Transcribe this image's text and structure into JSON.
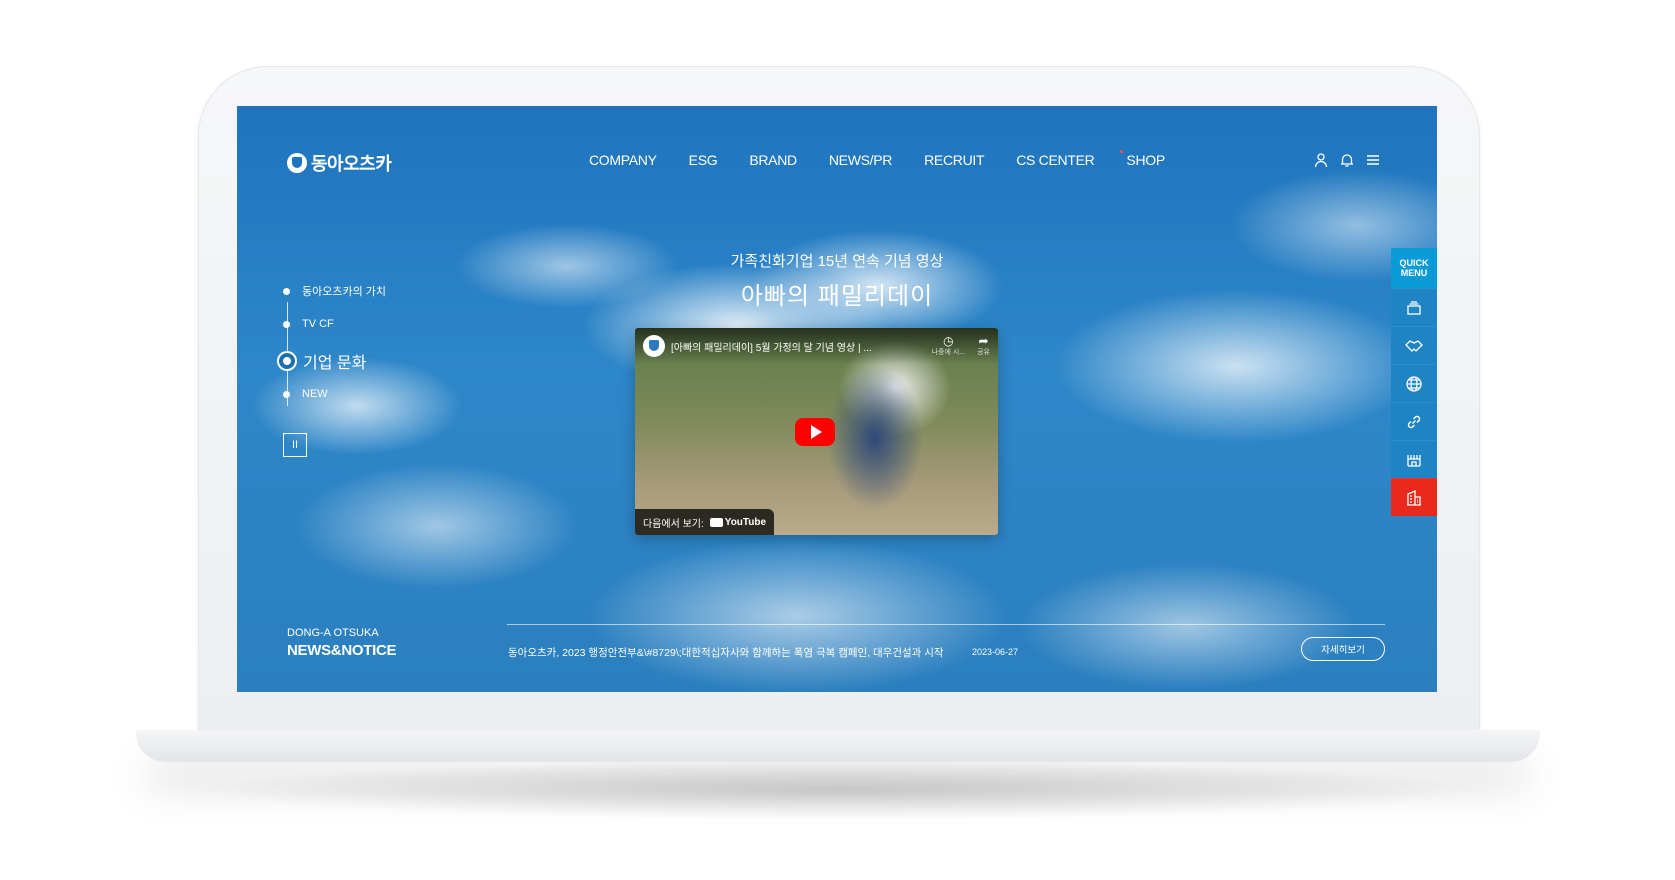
{
  "brand": {
    "logo_text": "동아오츠카"
  },
  "nav": {
    "items": [
      "COMPANY",
      "ESG",
      "BRAND",
      "NEWS/PR",
      "RECRUIT",
      "CS CENTER",
      "SHOP"
    ]
  },
  "top_icons": [
    "user-icon",
    "bell-icon",
    "menu-icon"
  ],
  "hero": {
    "subtitle": "가족친화기업 15년 연속 기념 영상",
    "title": "아빠의 패밀리데이"
  },
  "side_nav": {
    "items": [
      "동아오츠카의 가치",
      "TV CF",
      "기업 문화",
      "NEW"
    ],
    "active_index": 2,
    "pause_label": "II"
  },
  "video": {
    "title": "[아빠의 패밀리데이] 5월 가정의 달 기념 영상 | ...",
    "watch_later": "나중에 시...",
    "share": "공유",
    "watch_on": "다음에서 보기:",
    "platform": "YouTube"
  },
  "quick_menu": {
    "label_line1": "QUICK",
    "label_line2": "MENU",
    "items": [
      "layers-icon",
      "handshake-icon",
      "globe-icon",
      "link-icon",
      "factory-icon",
      "building-icon"
    ],
    "highlight_color": "#e8291c",
    "accent_color": "#0a9bd6"
  },
  "news": {
    "label_small": "DONG-A OTSUKA",
    "label_big": "NEWS&NOTICE",
    "headline": "동아오츠카, 2023 행정안전부&\\#8729\\;대한적십자사와 함께하는 폭염 극복 캠페인, 대우건설과 시작",
    "date": "2023-06-27",
    "more_label": "자세히보기"
  }
}
